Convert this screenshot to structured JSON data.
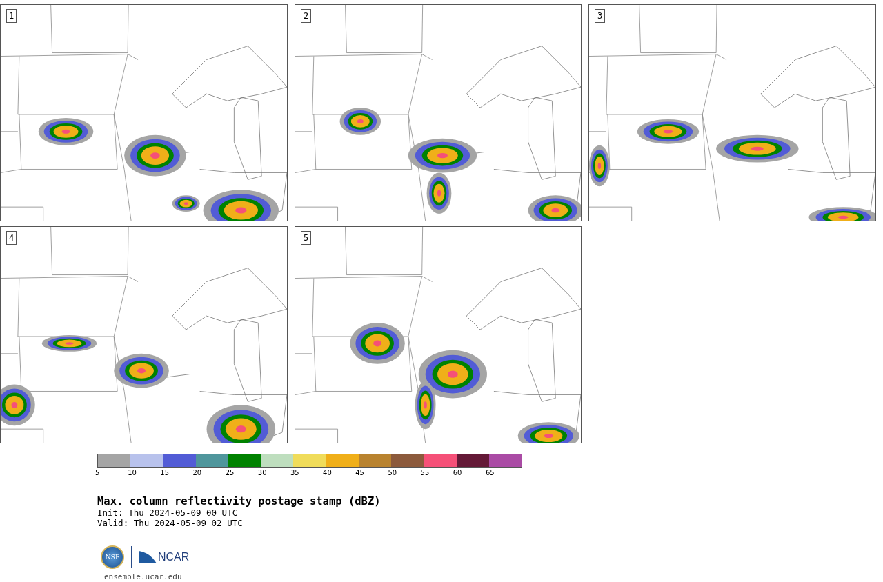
{
  "panels": [
    {
      "label": "1"
    },
    {
      "label": "2"
    },
    {
      "label": "3"
    },
    {
      "label": "4"
    },
    {
      "label": "5"
    }
  ],
  "colorbar": {
    "colors": [
      {
        "color": "#a5a5a5"
      },
      {
        "color": "#b8c2ec"
      },
      {
        "color": "#525cd6"
      },
      {
        "color": "#4f969c"
      },
      {
        "color": "#008200"
      },
      {
        "color": "#bedebe"
      },
      {
        "color": "#f0dc5a"
      },
      {
        "color": "#f0af19"
      },
      {
        "color": "#b9832f"
      },
      {
        "color": "#8c5a3c"
      },
      {
        "color": "#f55078"
      },
      {
        "color": "#641937"
      },
      {
        "color": "#aa4ba5"
      }
    ],
    "ticks": [
      "5",
      "10",
      "15",
      "20",
      "25",
      "30",
      "35",
      "40",
      "45",
      "50",
      "55",
      "60",
      "65"
    ]
  },
  "title": "Max. column reflectivity postage stamp (dBZ)",
  "init": " Init: Thu 2024-05-09 00 UTC",
  "valid": "Valid: Thu 2024-05-09 02 UTC",
  "logos": {
    "seal": "NSF",
    "wordmark": "NCAR"
  },
  "site": "ensemble.ucar.edu"
}
